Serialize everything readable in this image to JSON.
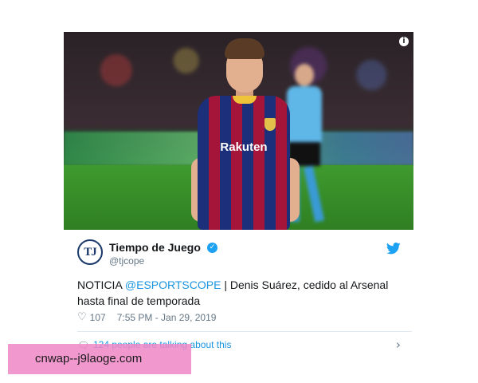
{
  "media": {
    "sponsor_text": "Rakuten",
    "info_icon": "info-icon"
  },
  "account": {
    "avatar_text": "TJ",
    "name": "Tiempo de Juego",
    "handle": "@tjcope",
    "verified_icon": "verified-badge-icon",
    "brand_icon": "twitter-bird-icon"
  },
  "tweet": {
    "prefix": "NOTICIA ",
    "mention": "@ESPORTSCOPE",
    "body": " | Denis Suárez, cedido al Arsenal hasta final de temporada",
    "likes": "107",
    "timestamp": "7:55 PM - Jan 29, 2019"
  },
  "footer": {
    "talking": "124 people are talking about this"
  },
  "watermark": "cnwap--j9laoge.com",
  "colors": {
    "link": "#1b95e0",
    "verified": "#1da1f2",
    "muted": "#657786",
    "watermark_bg": "#ef86c5"
  }
}
